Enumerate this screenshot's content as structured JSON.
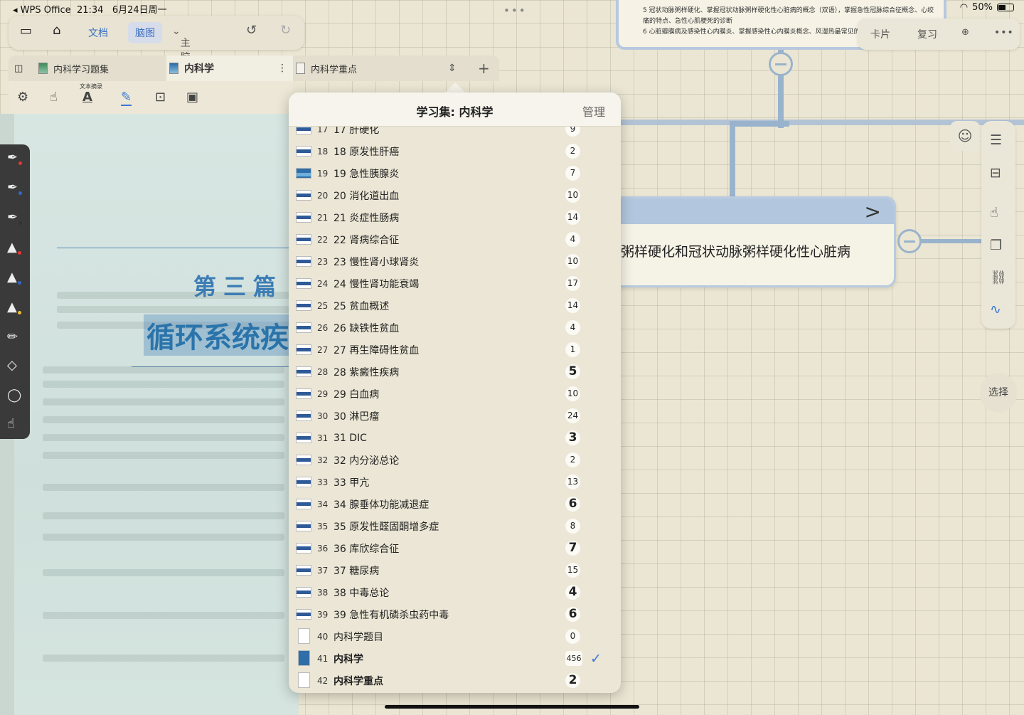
{
  "status": {
    "app": "◂ WPS Office",
    "time": "21:34",
    "date": "6月24日周一",
    "battery": "50%"
  },
  "toolbar": {
    "doc_label": "文档",
    "mindmap_label": "脑图",
    "mindmap_dropdown": "主脑图"
  },
  "tabs": [
    {
      "label": "内科学习题集"
    },
    {
      "label": "内科学"
    },
    {
      "label": "内科学重点"
    }
  ],
  "tools": {
    "excerpt_label": "文本摘录"
  },
  "pdf": {
    "part": "第三篇",
    "title": "循环系统疾"
  },
  "top_card": {
    "line1": "5 冠状动脉粥样硬化、掌握冠状动脉粥样硬化性心脏病的概念（双语），掌握急性冠脉综合征概念、心绞",
    "line2": "痛的特点、急性心肌梗死的诊断",
    "line3": "6 心脏瓣膜病及感染性心内膜炎、掌握感染性心内膜炎概念、风湿热最常见的细菌"
  },
  "top_tabs": {
    "card": "卡片",
    "review": "复习"
  },
  "node": {
    "text": "粥样硬化和冠状动脉粥样硬化性心脏病"
  },
  "select_label": "选择",
  "popover": {
    "title": "学习集: 内科学",
    "manage": "管理",
    "items": [
      {
        "num": "17",
        "name": "17 肝硬化",
        "count": "9",
        "style": "a"
      },
      {
        "num": "18",
        "name": "18 原发性肝癌",
        "count": "2",
        "style": "a"
      },
      {
        "num": "19",
        "name": "19 急性胰腺炎",
        "count": "7",
        "style": "b"
      },
      {
        "num": "20",
        "name": "20 消化道出血",
        "count": "10",
        "style": "a"
      },
      {
        "num": "21",
        "name": "21 炎症性肠病",
        "count": "14",
        "style": "a"
      },
      {
        "num": "22",
        "name": "22 肾病综合征",
        "count": "4",
        "style": "a"
      },
      {
        "num": "23",
        "name": "23 慢性肾小球肾炎",
        "count": "10",
        "style": "a"
      },
      {
        "num": "24",
        "name": "24 慢性肾功能衰竭",
        "count": "17",
        "style": "a"
      },
      {
        "num": "25",
        "name": "25 贫血概述",
        "count": "14",
        "style": "a"
      },
      {
        "num": "26",
        "name": "26 缺铁性贫血",
        "count": "4",
        "style": "a"
      },
      {
        "num": "27",
        "name": "27 再生障碍性贫血",
        "count": "1",
        "style": "a"
      },
      {
        "num": "28",
        "name": "28 紫癜性疾病",
        "count": "5",
        "style": "big"
      },
      {
        "num": "29",
        "name": "29 白血病",
        "count": "10",
        "style": "a"
      },
      {
        "num": "30",
        "name": "30 淋巴瘤",
        "count": "24",
        "style": "a"
      },
      {
        "num": "31",
        "name": "31 DIC",
        "count": "3",
        "style": "big"
      },
      {
        "num": "32",
        "name": "32 内分泌总论",
        "count": "2",
        "style": "a"
      },
      {
        "num": "33",
        "name": "33 甲亢",
        "count": "13",
        "style": "a"
      },
      {
        "num": "34",
        "name": "34 腺垂体功能减退症",
        "count": "6",
        "style": "big"
      },
      {
        "num": "35",
        "name": "35 原发性醛固酮增多症",
        "count": "8",
        "style": "a"
      },
      {
        "num": "36",
        "name": "36 库欣综合征",
        "count": "7",
        "style": "big"
      },
      {
        "num": "37",
        "name": "37 糖尿病",
        "count": "15",
        "style": "a"
      },
      {
        "num": "38",
        "name": "38 中毒总论",
        "count": "4",
        "style": "big"
      },
      {
        "num": "39",
        "name": "39 急性有机磷杀虫药中毒",
        "count": "6",
        "style": "big"
      },
      {
        "num": "40",
        "name": "内科学题目",
        "count": "0",
        "style": "p"
      },
      {
        "num": "41",
        "name": "内科学",
        "count": "456",
        "style": "sel"
      },
      {
        "num": "42",
        "name": "内科学重点",
        "count": "2",
        "style": "bp"
      }
    ]
  },
  "colors": {
    "accent": "#3a78d6",
    "node_header": "#b2c7de",
    "connector": "#9ab3cc"
  }
}
